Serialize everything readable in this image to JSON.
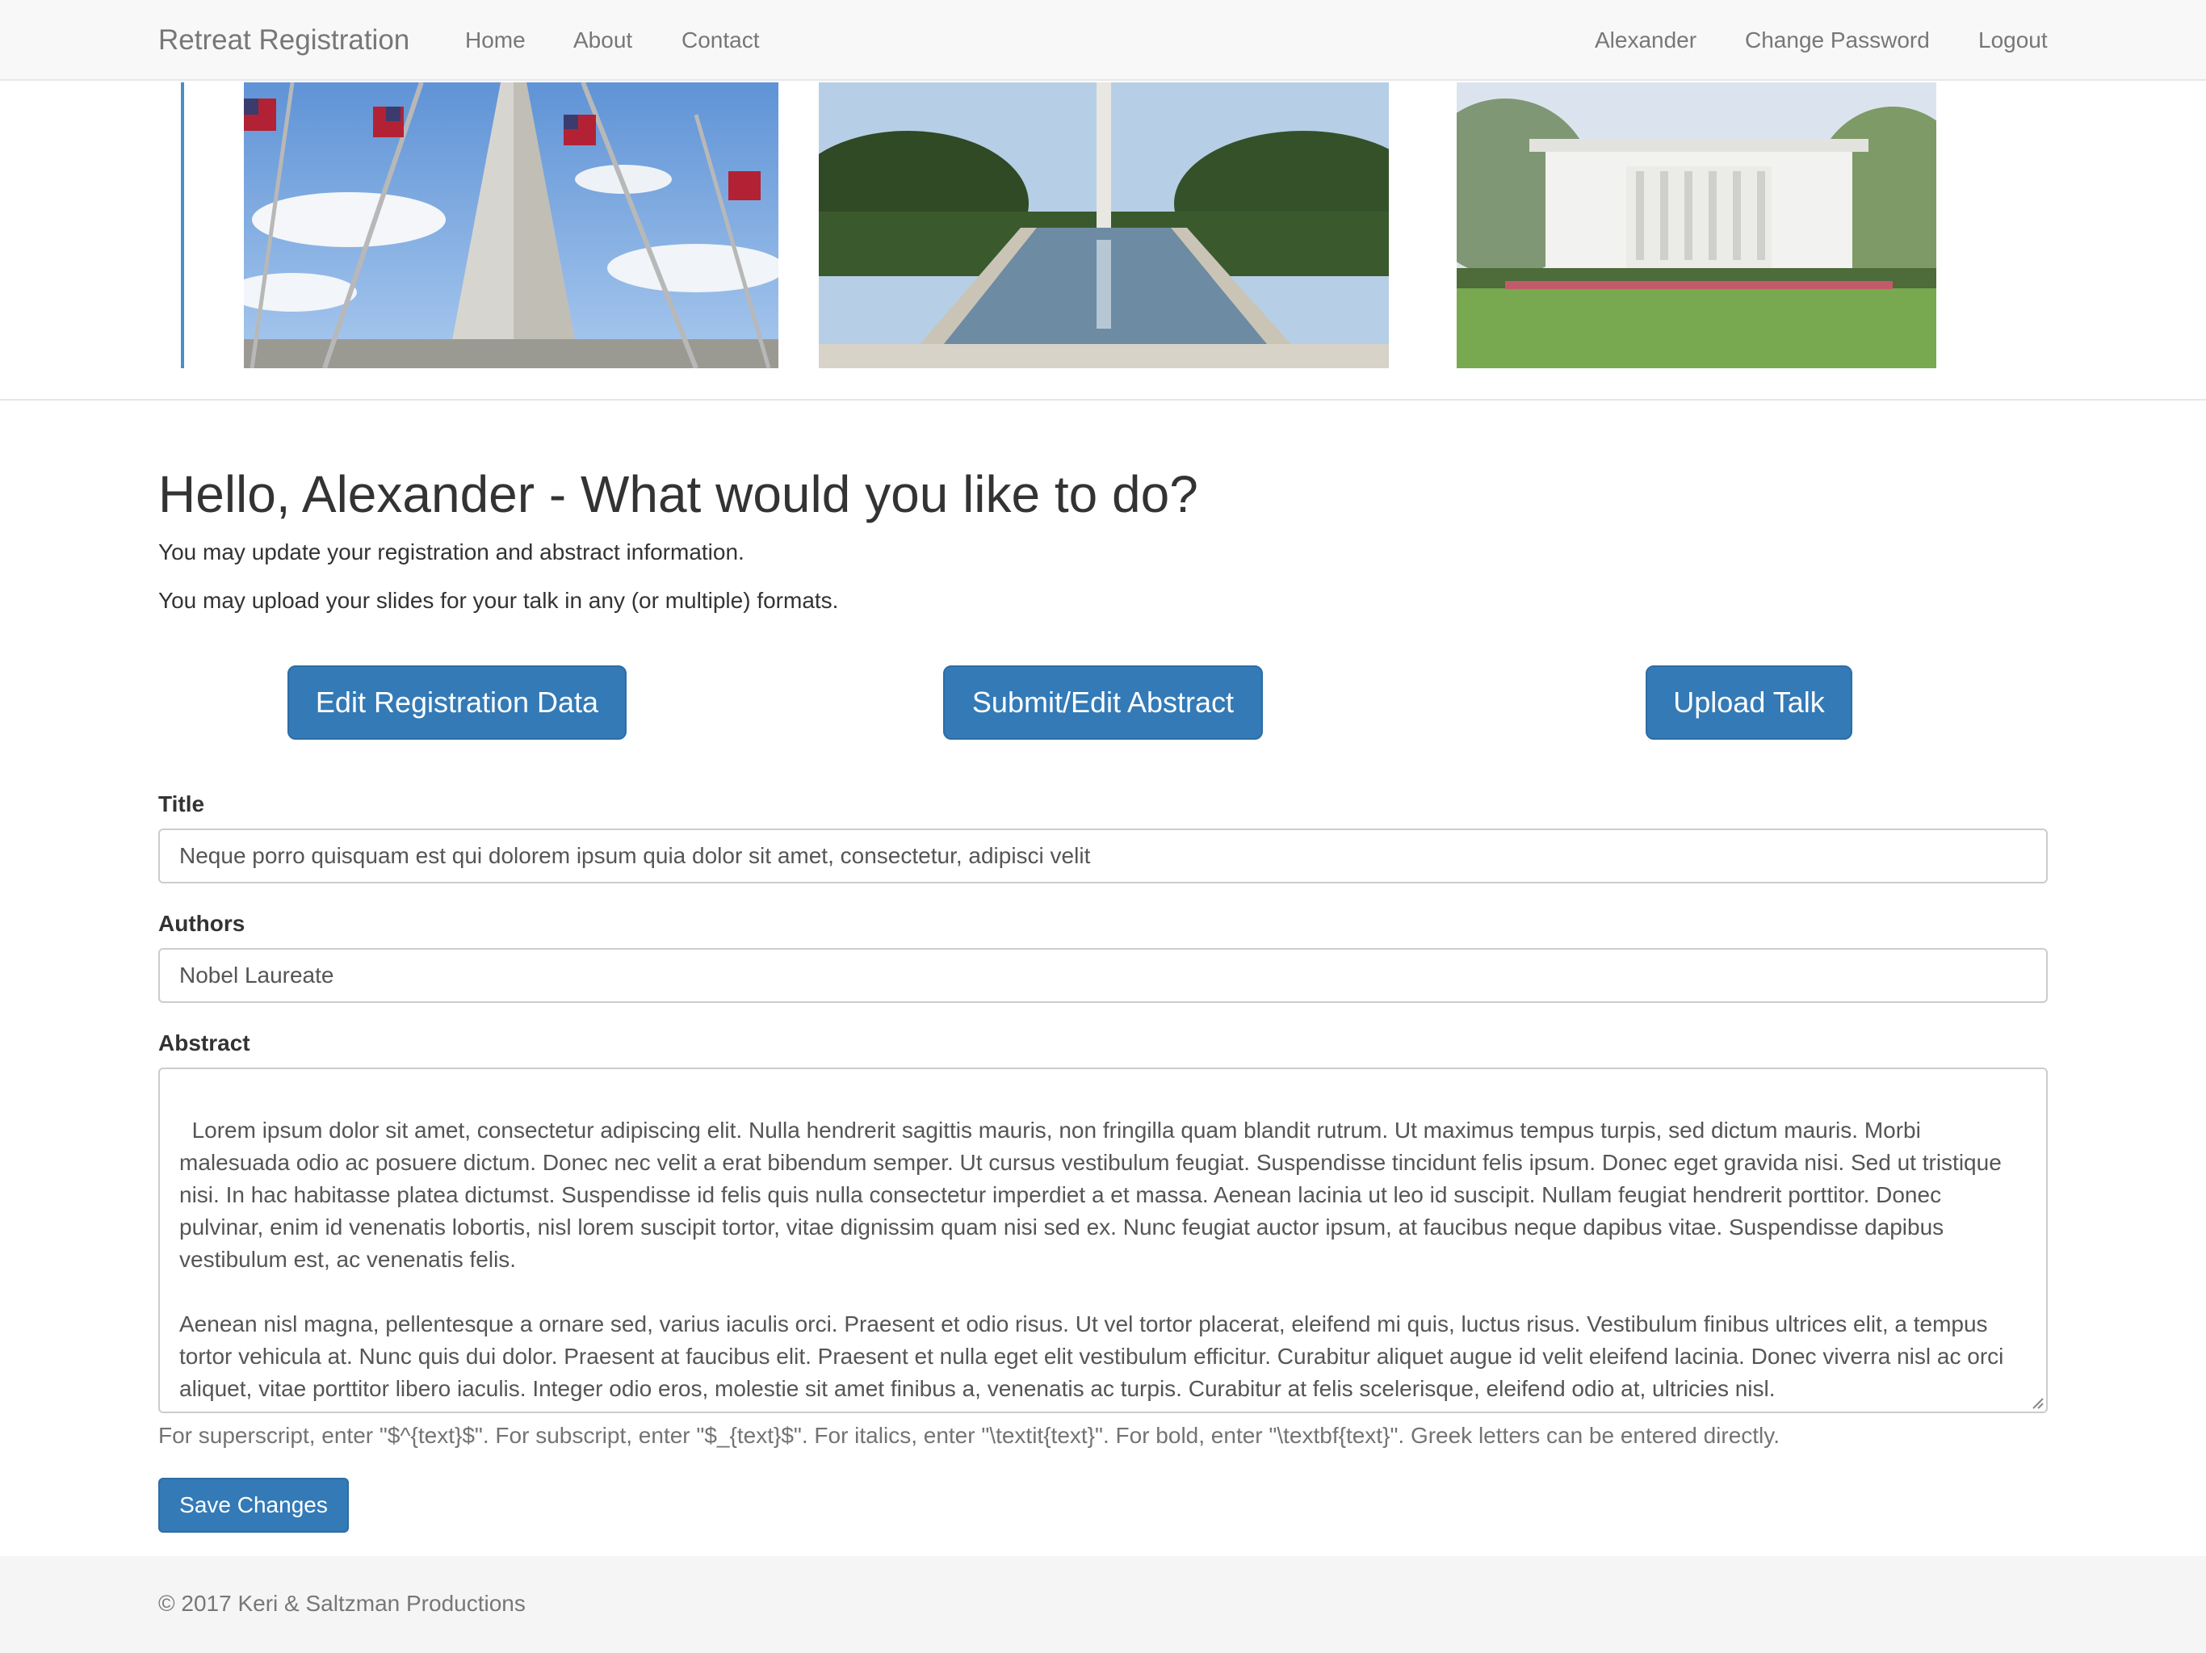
{
  "navbar": {
    "brand": "Retreat Registration",
    "links": [
      "Home",
      "About",
      "Contact"
    ],
    "user": "Alexander",
    "change_password": "Change Password",
    "logout": "Logout"
  },
  "carousel": {
    "slides": [
      "washington-monument-flags-photo",
      "reflecting-pool-photo",
      "white-house-photo"
    ]
  },
  "main": {
    "greeting": "Hello, Alexander - What would you like to do?",
    "intro_1": "You may update your registration and abstract information.",
    "intro_2": "You may upload your slides for your talk in any (or multiple) formats.",
    "actions": [
      "Edit Registration Data",
      "Submit/Edit Abstract",
      "Upload Talk"
    ]
  },
  "form": {
    "title_label": "Title",
    "title_value": "Neque porro quisquam est qui dolorem ipsum quia dolor sit amet, consectetur, adipisci velit",
    "authors_label": "Authors",
    "authors_value": "Nobel Laureate",
    "abstract_label": "Abstract",
    "abstract_value": "Lorem ipsum dolor sit amet, consectetur adipiscing elit. Nulla hendrerit sagittis mauris, non fringilla quam blandit rutrum. Ut maximus tempus turpis, sed dictum mauris. Morbi malesuada odio ac posuere dictum. Donec nec velit a erat bibendum semper. Ut cursus vestibulum feugiat. Suspendisse tincidunt felis ipsum. Donec eget gravida nisi. Sed ut tristique nisi. In hac habitasse platea dictumst. Suspendisse id felis quis nulla consectetur imperdiet a et massa. Aenean lacinia ut leo id suscipit. Nullam feugiat hendrerit porttitor. Donec pulvinar, enim id venenatis lobortis, nisl lorem suscipit tortor, vitae dignissim quam nisi sed ex. Nunc feugiat auctor ipsum, at faucibus neque dapibus vitae. Suspendisse dapibus vestibulum est, ac venenatis felis.\n\nAenean nisl magna, pellentesque a ornare sed, varius iaculis orci. Praesent et odio risus. Ut vel tortor placerat, eleifend mi quis, luctus risus. Vestibulum finibus ultrices elit, a tempus tortor vehicula at. Nunc quis dui dolor. Praesent at faucibus elit. Praesent et nulla eget elit vestibulum efficitur. Curabitur aliquet augue id velit eleifend lacinia. Donec viverra nisl ac orci aliquet, vitae porttitor libero iaculis. Integer odio eros, molestie sit amet finibus a, venenatis ac turpis. Curabitur at felis scelerisque, eleifend odio at, ultricies nisl.",
    "help_text": "For superscript, enter \"$^{text}$\". For subscript, enter \"$_{text}$\". For italics, enter \"\\textit{text}\". For bold, enter \"\\textbf{text}\". Greek letters can be entered directly.",
    "save_label": "Save Changes"
  },
  "footer": {
    "copyright": "© 2017 Keri & Saltzman Productions"
  },
  "colors": {
    "primary": "#337ab7",
    "navbar_bg": "#f8f8f8",
    "footer_bg": "#f5f5f5"
  }
}
